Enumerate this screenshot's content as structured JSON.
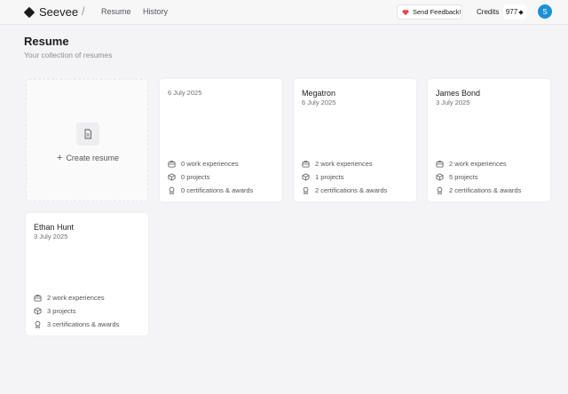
{
  "header": {
    "brand": "Seevee",
    "separator": "/",
    "nav": {
      "resume": "Resume",
      "history": "History"
    },
    "feedback_label": "Send Feedback!",
    "credits_label": "Credits",
    "credits_value": "977",
    "avatar_initial": "S",
    "accent_color": "#1d8fd6",
    "heart_color": "#e5484d"
  },
  "page": {
    "title": "Resume",
    "subtitle": "Your collection of resumes"
  },
  "create_card": {
    "label": "Create resume",
    "icon": "document-icon"
  },
  "resumes": [
    {
      "name": "",
      "date": "6 July 2025",
      "work": "0 work experiences",
      "projects": "0 projects",
      "certs": "0 certifications & awards"
    },
    {
      "name": "Megatron",
      "date": "6 July 2025",
      "work": "2 work experiences",
      "projects": "1 projects",
      "certs": "2 certifications & awards"
    },
    {
      "name": "James Bond",
      "date": "3 July 2025",
      "work": "2 work experiences",
      "projects": "5 projects",
      "certs": "2 certifications & awards"
    },
    {
      "name": "Ethan Hunt",
      "date": "3 July 2025",
      "work": "2 work experiences",
      "projects": "3 projects",
      "certs": "3 certifications & awards"
    }
  ]
}
